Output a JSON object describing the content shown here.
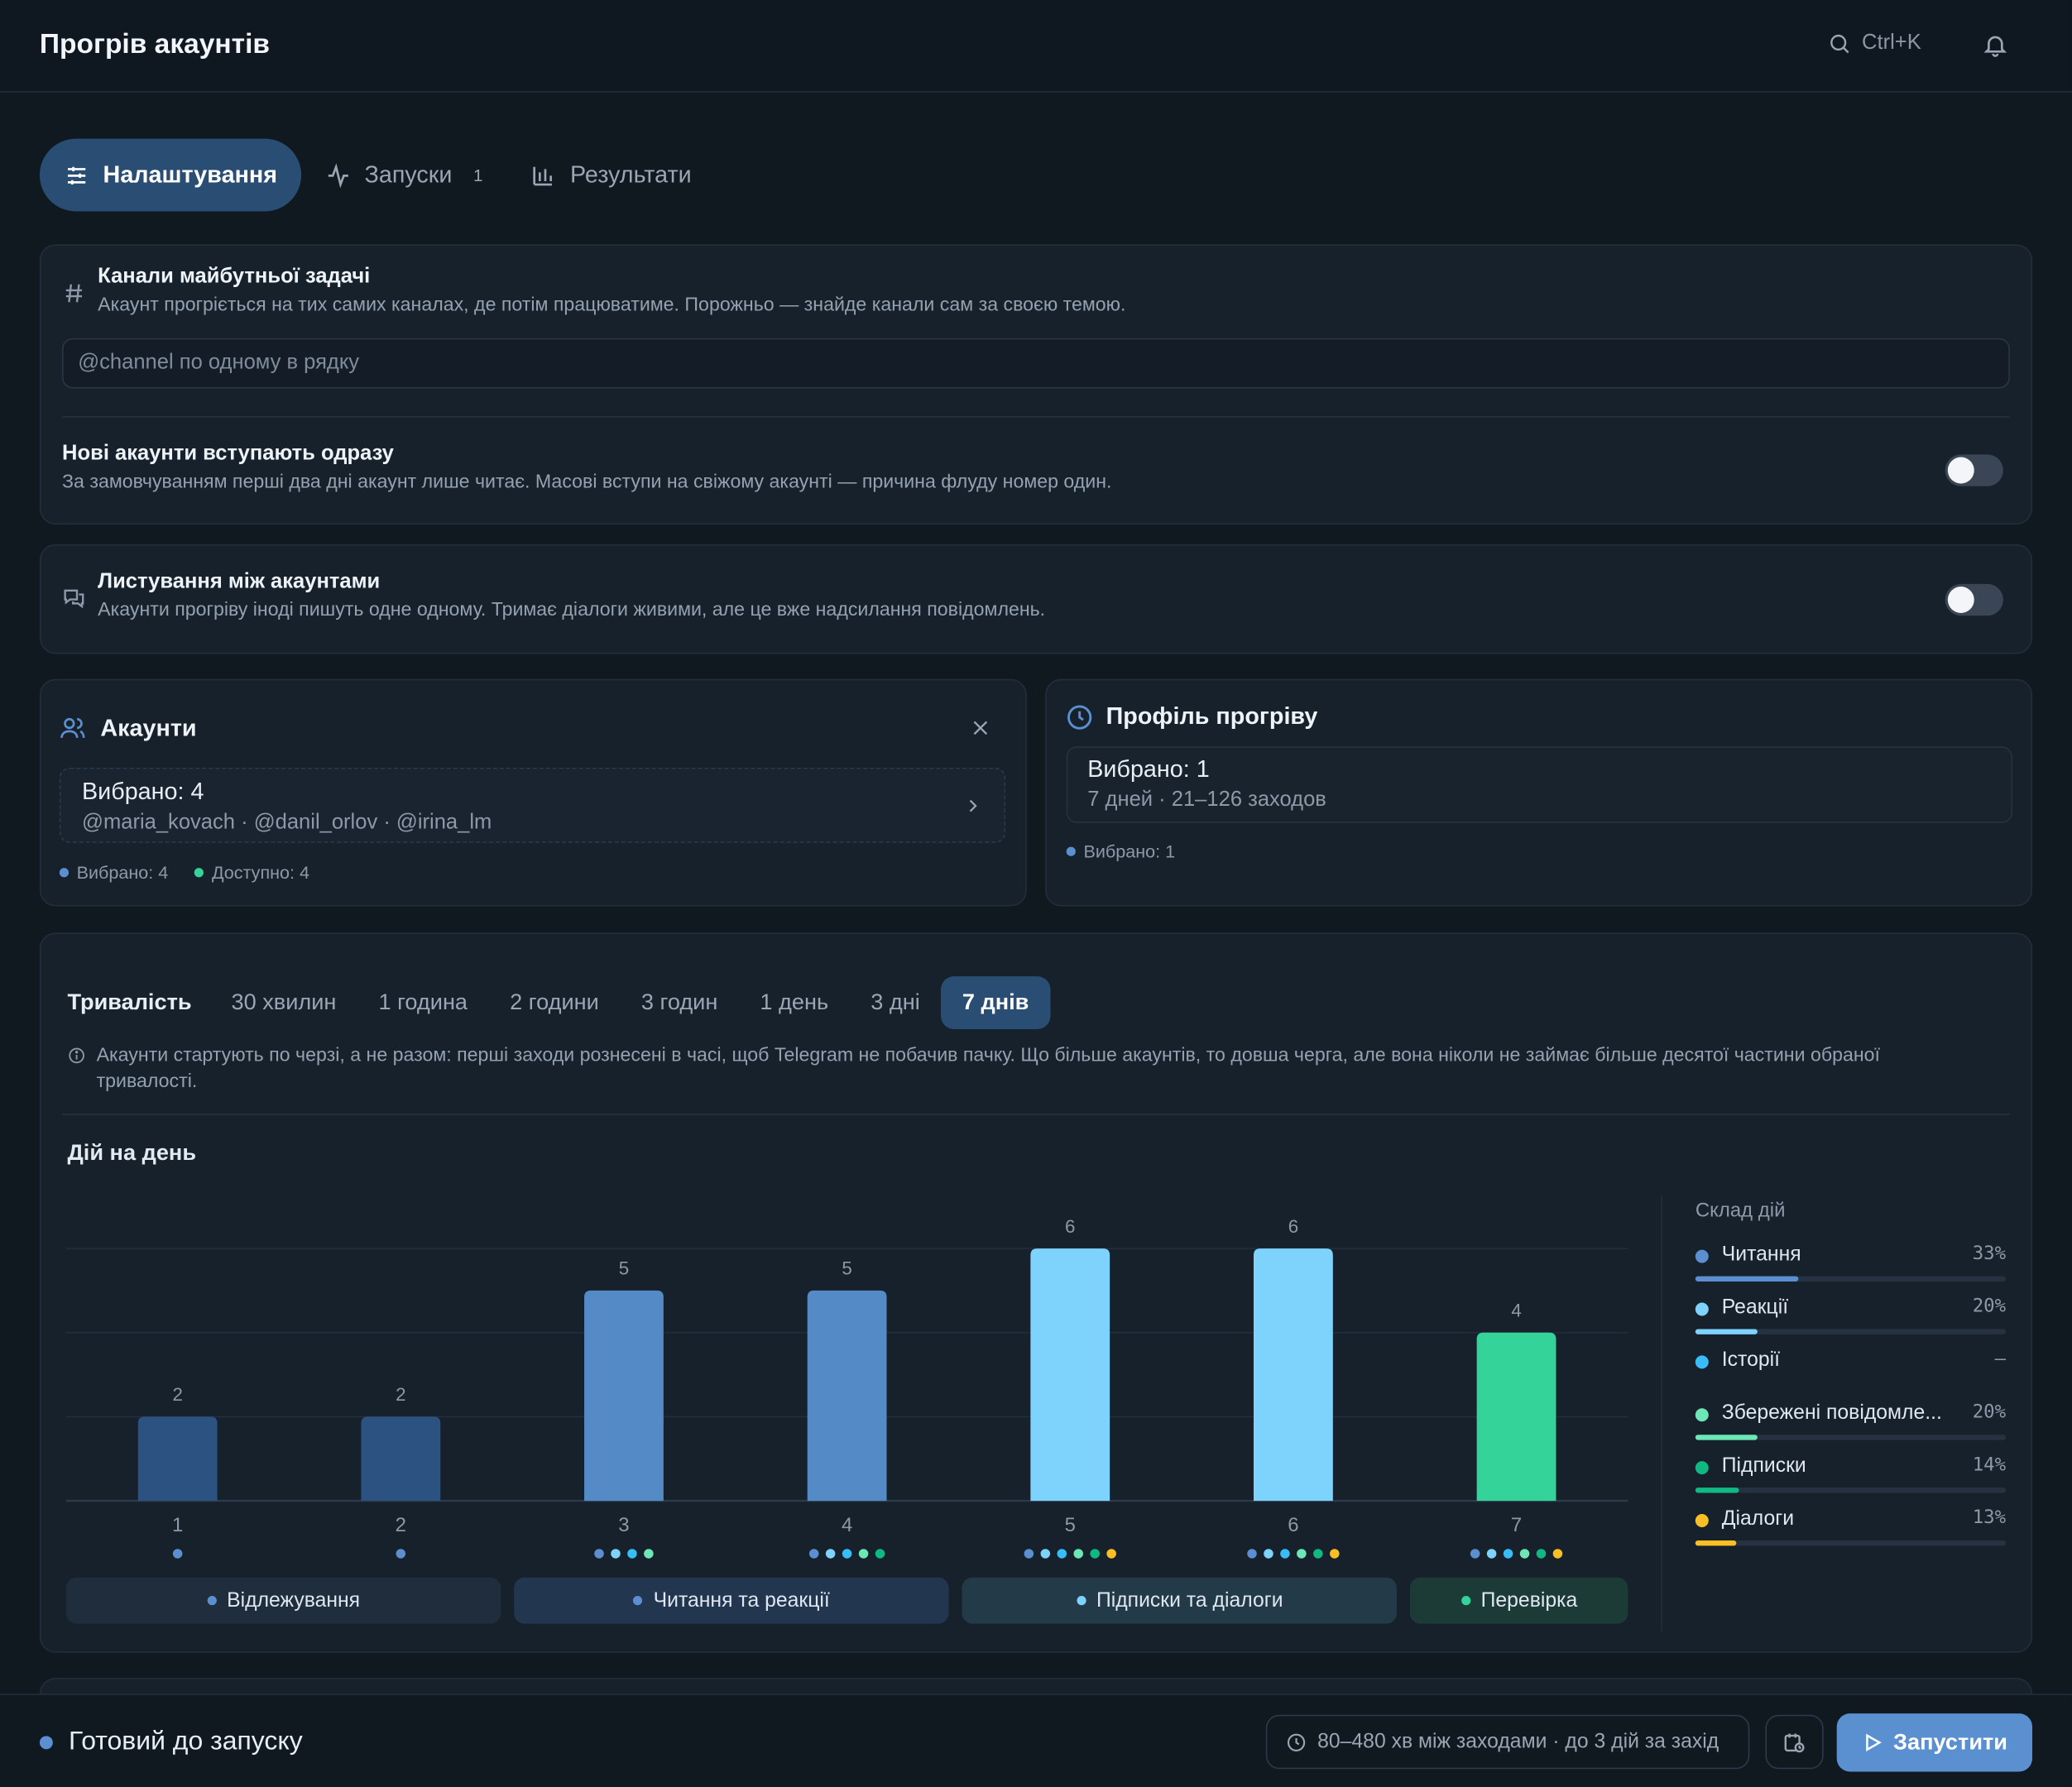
{
  "header": {
    "title": "Прогрів акаунтів",
    "search_shortcut": "Ctrl+K"
  },
  "tabs": [
    {
      "label": "Налаштування",
      "active": true
    },
    {
      "label": "Запуски",
      "count": "1"
    },
    {
      "label": "Результати"
    }
  ],
  "channels": {
    "title": "Канали майбутньої задачі",
    "description": "Акаунт прогріється на тих самих каналах, де потім працюватиме. Порожньо — знайде канали сам за своєю темою.",
    "placeholder": "@channel по одному в рядку",
    "join_title": "Нові акаунти вступають одразу",
    "join_description": "За замовчуванням перші два дні акаунт лише читає. Масові вступи на свіжому акаунті — причина флуду номер один.",
    "join_enabled": false
  },
  "chatting": {
    "title": "Листування між акаунтами",
    "description": "Акаунти прогріву іноді пишуть одне одному. Тримає діалоги живими, але це вже надсилання повідомлень.",
    "enabled": false
  },
  "accounts": {
    "title": "Акаунти",
    "selected_text": "Вибрано: 4",
    "handles": "@maria_kovach · @danil_orlov · @irina_lm",
    "stat_selected": "Вибрано: 4",
    "stat_available": "Доступно: 4"
  },
  "profile": {
    "title": "Профіль прогріву",
    "selected_text": "Вибрано: 1",
    "details": "7 дней · 21–126 заходов",
    "stat_selected": "Вибрано: 1"
  },
  "duration": {
    "label": "Тривалість",
    "options": [
      "30 хвилин",
      "1 година",
      "2 години",
      "3 годин",
      "1 день",
      "3 дні",
      "7 днів"
    ],
    "selected": "7 днів",
    "info": "Акаунти стартують по черзі, а не разом: перші заходи рознесені в часі, щоб Telegram не побачив пачку. Що більше акаунтів, то довша черга, але вона ніколи не займає більше десятої частини обраної тривалості."
  },
  "chart_data": {
    "type": "bar",
    "title": "Дій на день",
    "categories": [
      "1",
      "2",
      "3",
      "4",
      "5",
      "6",
      "7"
    ],
    "values": [
      2,
      2,
      5,
      5,
      6,
      6,
      4
    ],
    "ylim": [
      0,
      6
    ],
    "grid": true,
    "bar_colors": [
      "#2c5282",
      "#2c5282",
      "#548ac6",
      "#548ac6",
      "#7dd3fc",
      "#7dd3fc",
      "#34d399"
    ],
    "day_action_dots": [
      [
        "#5b8fd0"
      ],
      [
        "#5b8fd0"
      ],
      [
        "#5b8fd0",
        "#7dd3fc",
        "#38bdf8",
        "#6ee7b7"
      ],
      [
        "#5b8fd0",
        "#7dd3fc",
        "#38bdf8",
        "#6ee7b7",
        "#10b981"
      ],
      [
        "#5b8fd0",
        "#7dd3fc",
        "#38bdf8",
        "#6ee7b7",
        "#10b981",
        "#fbbf24"
      ],
      [
        "#5b8fd0",
        "#7dd3fc",
        "#38bdf8",
        "#6ee7b7",
        "#10b981",
        "#fbbf24"
      ],
      [
        "#5b8fd0",
        "#7dd3fc",
        "#38bdf8",
        "#6ee7b7",
        "#10b981",
        "#fbbf24"
      ]
    ],
    "phases": [
      {
        "label": "Відлежування",
        "days": 2,
        "color": "#5b8fd0",
        "bg": "#1f2d3d"
      },
      {
        "label": "Читання та реакції",
        "days": 2,
        "color": "#5b8fd0",
        "bg": "#233650"
      },
      {
        "label": "Підписки та діалоги",
        "days": 2,
        "color": "#7dd3fc",
        "bg": "#233a48"
      },
      {
        "label": "Перевірка",
        "days": 1,
        "color": "#34d399",
        "bg": "#1d3b36"
      }
    ]
  },
  "composition": {
    "title": "Склад дій",
    "items": [
      {
        "name": "Читання",
        "pct": "33%",
        "fraction": 0.33,
        "color": "#5b8fd0"
      },
      {
        "name": "Реакції",
        "pct": "20%",
        "fraction": 0.2,
        "color": "#7dd3fc"
      },
      {
        "name": "Історії",
        "pct": "—",
        "fraction": 0,
        "color": "#38bdf8"
      },
      {
        "name": "Збережені повідомле...",
        "pct": "20%",
        "fraction": 0.2,
        "color": "#6ee7b7"
      },
      {
        "name": "Підписки",
        "pct": "14%",
        "fraction": 0.14,
        "color": "#10b981"
      },
      {
        "name": "Діалоги",
        "pct": "13%",
        "fraction": 0.13,
        "color": "#fbbf24"
      }
    ]
  },
  "footer": {
    "status": "Готовий до запуску",
    "status_color": "#5b8fd0",
    "schedule": "80–480 хв між заходами · до 3 дій за захід",
    "run_label": "Запустити"
  }
}
